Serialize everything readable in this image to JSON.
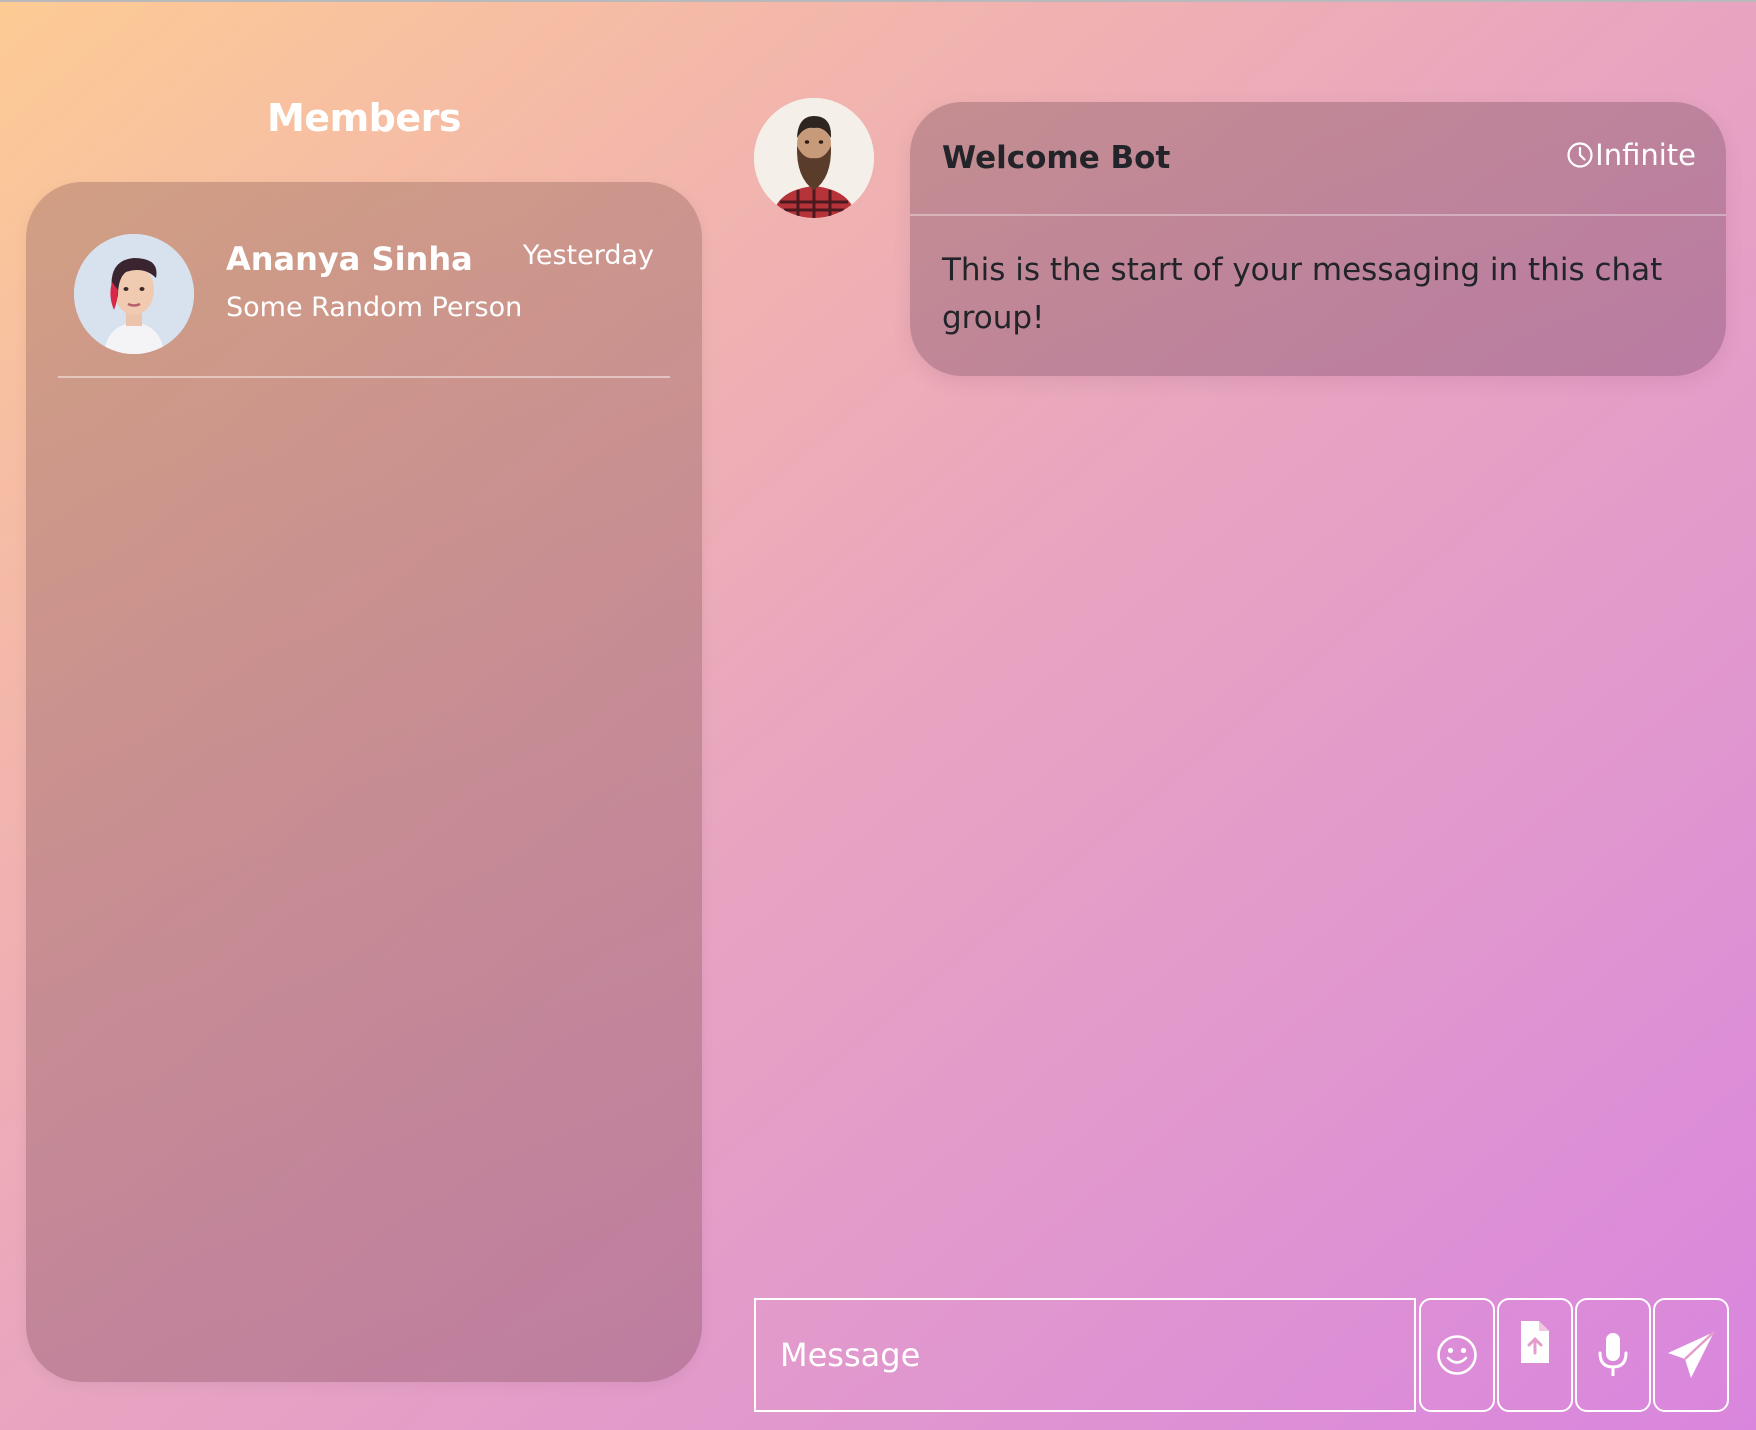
{
  "members_panel": {
    "title": "Members",
    "members": [
      {
        "name": "Ananya Sinha",
        "subtitle": "Some Random Person",
        "time": "Yesterday",
        "avatar_icon": "user-avatar"
      }
    ]
  },
  "chat": {
    "messages": [
      {
        "sender": "Welcome Bot",
        "time": "Infinite",
        "text": "This is the start of your messaging in this chat group!",
        "avatar_icon": "bot-avatar"
      }
    ]
  },
  "composer": {
    "placeholder": "Message",
    "value": "",
    "buttons": [
      {
        "icon": "emoji-icon"
      },
      {
        "icon": "file-upload-icon"
      },
      {
        "icon": "microphone-icon"
      },
      {
        "icon": "send-icon"
      }
    ]
  },
  "colors": {
    "background_start": "#fdcb94",
    "background_end": "#d985de",
    "text_dark": "#222429",
    "text_light": "#ffffff"
  }
}
